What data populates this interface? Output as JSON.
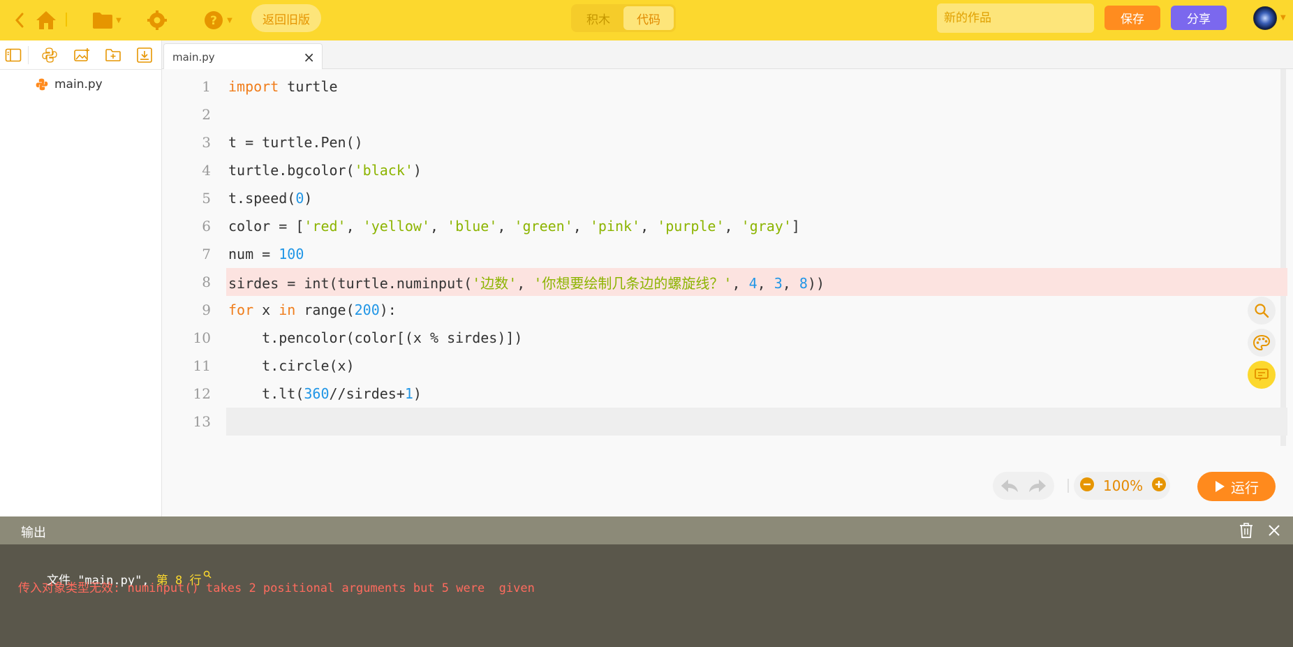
{
  "topbar": {
    "old_version_label": "返回旧版",
    "mode_tabs": [
      "积木",
      "代码"
    ],
    "active_mode": "代码",
    "project_title_placeholder": "新的作品",
    "save_label": "保存",
    "share_label": "分享"
  },
  "sidebar": {
    "files": [
      "main.py"
    ]
  },
  "editor": {
    "tab_label": "main.py",
    "close_glyph": "×",
    "line_numbers": [
      "1",
      "2",
      "3",
      "4",
      "5",
      "6",
      "7",
      "8",
      "9",
      "10",
      "11",
      "12",
      "13"
    ],
    "lines": [
      "import turtle",
      "",
      "t = turtle.Pen()",
      "turtle.bgcolor('black')",
      "t.speed(0)",
      "color = ['red', 'yellow', 'blue', 'green', 'pink', 'purple', 'gray']",
      "num = 100",
      "sirdes = int(turtle.numinput('边数', '你想要绘制几条边的螺旋线？', 4, 3, 8))",
      "for x in range(200):",
      "    t.pencolor(color[(x % sirdes)])",
      "    t.circle(x)",
      "    t.lt(360//sirdes+1)",
      ""
    ],
    "error_line": 8,
    "current_line": 13
  },
  "controls": {
    "zoom": "100%",
    "run_label": "运行"
  },
  "output": {
    "title": "输出",
    "location_prefix": "文件 \"main.py\", ",
    "location_line": "第 8 行",
    "error_message": "传入对象类型无效: numinput() takes 2 positional arguments but 5 were  given"
  },
  "colors": {
    "topbar": "#fcd82e",
    "accent_orange": "#ff8a1d",
    "share_purple": "#7b68ee",
    "error_text": "#ff6b5e",
    "output_bg": "#5a574b"
  }
}
